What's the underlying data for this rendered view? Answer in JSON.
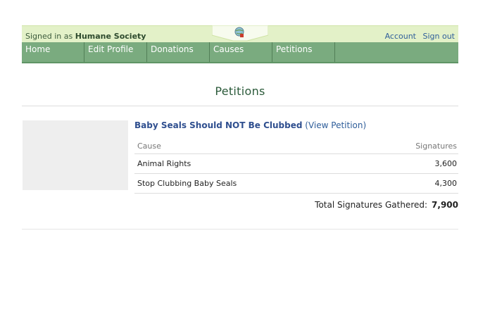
{
  "header": {
    "signed_prefix": "Signed in as",
    "signed_name": "Humane Society",
    "account": "Account",
    "sign_out": "Sign out"
  },
  "nav": [
    "Home",
    "Edit Profile",
    "Donations",
    "Causes",
    "Petitions"
  ],
  "page_title": "Petitions",
  "petition": {
    "title": "Baby Seals Should NOT Be Clubbed",
    "view_link": "(View Petition)",
    "col_cause": "Cause",
    "col_signatures": "Signatures",
    "rows": [
      {
        "cause": "Animal Rights",
        "signatures": "3,600"
      },
      {
        "cause": "Stop Clubbing Baby Seals",
        "signatures": "4,300"
      }
    ],
    "total_label": "Total Signatures Gathered:",
    "total_value": "7,900"
  },
  "colors": {
    "nav_bg": "#7aab7f",
    "topbar_bg": "#e3f1c8",
    "link": "#2f5e9a",
    "title": "#2b5a3a"
  }
}
